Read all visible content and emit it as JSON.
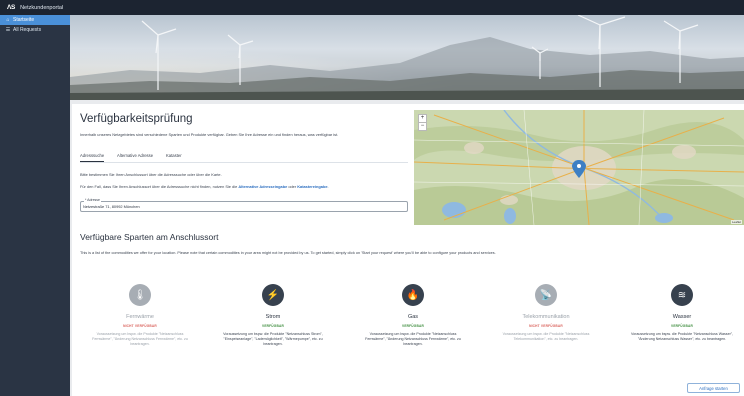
{
  "app": {
    "logo_text": "ΛS",
    "title": "Netzkundenportal"
  },
  "sidebar": {
    "items": [
      {
        "label": "Startseite",
        "icon": "home-icon",
        "active": true
      },
      {
        "label": "All Requests",
        "icon": "list-icon",
        "active": false
      }
    ]
  },
  "main": {
    "title": "Verfügbarkeitsprüfung",
    "intro": "Innerhalb unseres Netzgebietes sind verschiedene Sparten und Produkte verfügbar. Geben Sie Ihre Adresse ein und finden heraus, was verfügbar ist.",
    "tabs": [
      {
        "label": "Adresssuche",
        "active": true
      },
      {
        "label": "Alternative Adresse",
        "active": false
      },
      {
        "label": "Kataster",
        "active": false
      }
    ],
    "hint1": "Bitte bestimmen Sie Ihren Anschlussort über die Adresssuche oder über die Karte.",
    "hint2_prefix": "Für den Fall, dass Sie Ihren Anschlussort über die Adresssuche nicht finden, nutzen Sie die ",
    "hint2_link1": "Alternative Adresseingabe",
    "hint2_mid": " oder ",
    "hint2_link2": "Katastereingabe",
    "hint2_suffix": ".",
    "address": {
      "label": "* Adresse",
      "value": "Netzestraße 71, 80992 München"
    }
  },
  "map": {
    "zoom_in": "+",
    "zoom_out": "−",
    "attribution": "Leaflet"
  },
  "commodities": {
    "title": "Verfügbare Sparten am Anschlussort",
    "description": "This is a list of the commodities we offer for your location. Please note that certain commodities in your area might not be provided by us. To get started, simply click on 'Start your request' where you'll be able to configure your products and services.",
    "items": [
      {
        "name": "Fernwärme",
        "status": "NICHT VERFÜGBAR",
        "available": false,
        "icon": "thermometer-icon",
        "glyph": "🌡",
        "desc": "Voraussetzung um bspw. die Produkte \"Netzanschluss Fernwärme\", \"Änderung Netzanschluss Fernwärme\", etc. zu beantragen."
      },
      {
        "name": "Strom",
        "status": "VERFÜGBAR",
        "available": true,
        "icon": "plug-icon",
        "glyph": "⚡",
        "desc": "Voraussetzung um bspw. die Produkte \"Netzanschluss Strom\", \"Einspeiseanlage\", \"Lademöglichkeit\", \"Wärmepumpe\", etc. zu beantragen."
      },
      {
        "name": "Gas",
        "status": "VERFÜGBAR",
        "available": true,
        "icon": "flame-icon",
        "glyph": "🔥",
        "desc": "Voraussetzung um bspw. die Produkte \"Netzanschluss Fernwärme\", \"Änderung Netzanschluss Fernwärme\", etc. zu beantragen."
      },
      {
        "name": "Telekommunikation",
        "status": "NICHT VERFÜGBAR",
        "available": false,
        "icon": "antenna-icon",
        "glyph": "📡",
        "desc": "Voraussetzung um bspw. die Produkte \"Netzanschluss Telekommunikation\", etc. zu beantragen."
      },
      {
        "name": "Wasser",
        "status": "VERFÜGBAR",
        "available": true,
        "icon": "water-icon",
        "glyph": "≋",
        "desc": "Voraussetzung um bspw. die Produkte \"Netzanschluss Wasser\", \"Änderung Netzanschluss Wasser\", etc. zu beantragen."
      }
    ]
  },
  "actions": {
    "start_label": "Anfrage starten"
  },
  "colors": {
    "accent": "#4a90d9",
    "available": "#3c8c3c",
    "unavailable": "#d9605a",
    "sidebar": "#2a3444",
    "topbar": "#1c2431"
  }
}
